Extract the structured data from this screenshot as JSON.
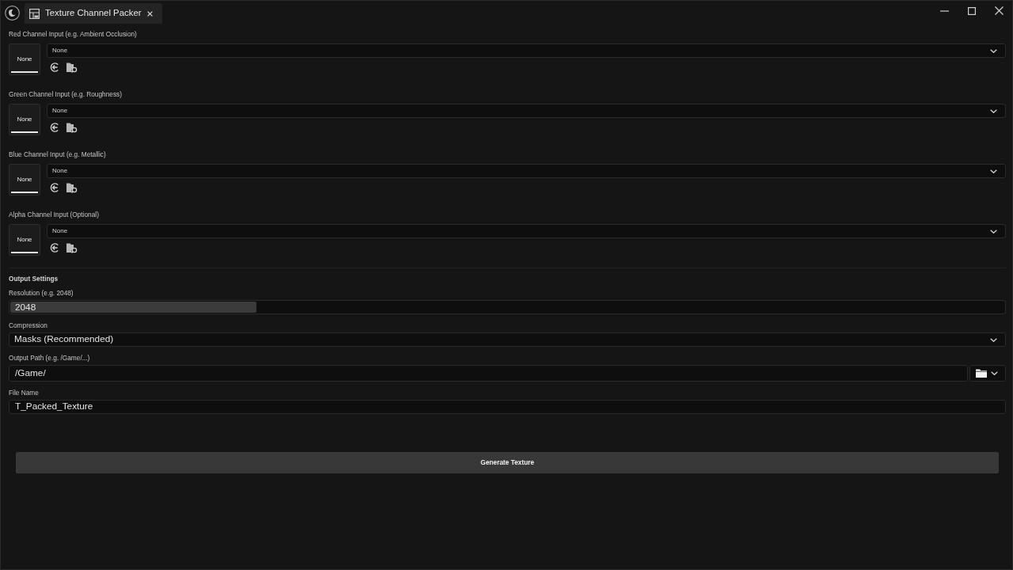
{
  "tabs": [
    {
      "label": "Texture Channel Packer",
      "selected": true
    }
  ],
  "channel_inputs": [
    {
      "label": "Red Channel Input (e.g. Ambient Occlusion)",
      "thumbnail": "None",
      "asset": "None"
    },
    {
      "label": "Green Channel Input (e.g. Roughness)",
      "thumbnail": "None",
      "asset": "None"
    },
    {
      "label": "Blue Channel Input (e.g. Metallic)",
      "thumbnail": "None",
      "asset": "None"
    },
    {
      "label": "Alpha Channel Input (Optional)",
      "thumbnail": "None",
      "asset": "None"
    }
  ],
  "output_settings": {
    "heading": "Output Settings",
    "fields": [
      {
        "kind": "slider",
        "label": "Resolution (e.g. 2048)",
        "value": "2048",
        "level": 0.248
      },
      {
        "kind": "dropdown",
        "label": "Compression",
        "value": "Masks (Recommended)"
      },
      {
        "kind": "path",
        "label": "Output Path (e.g. /Game/...)",
        "value": "/Game/"
      },
      {
        "kind": "text",
        "label": "File Name",
        "value": "T_Packed_Texture"
      }
    ]
  },
  "generate_button": {
    "label": "Generate Texture"
  }
}
